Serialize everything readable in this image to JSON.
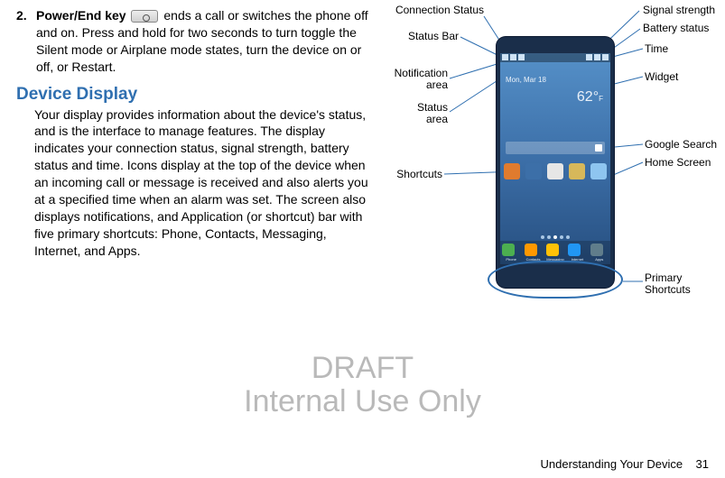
{
  "listItem": {
    "number": "2.",
    "label": "Power/End key",
    "textA": " ends a call or switches the phone off and on. Press and hold for two seconds to turn toggle the Silent mode or Airplane mode states, turn the device on or off, or Restart."
  },
  "sectionHead": "Device Display",
  "bodyPara": "Your display provides information about the device's status, and is the interface to manage features. The display indicates your connection status, signal strength, battery status and time. Icons display at the top of the device when an incoming call or message is received and also alerts you at a specified time when an alarm was set. The screen also displays notifications, and Application (or shortcut) bar with five primary shortcuts: Phone, Contacts, Messaging, Internet, and Apps.",
  "callouts": {
    "signal": "Signal strength",
    "battery": "Battery status",
    "connection": "Connection Status",
    "statusbar": "Status Bar",
    "time": "Time",
    "widget": "Widget",
    "notification": "Notification\narea",
    "statusarea": "Status\narea",
    "gsearch": "Google Search",
    "homescreen": "Home Screen",
    "shortcuts": "Shortcuts",
    "primary": "Primary\nShortcuts"
  },
  "phone": {
    "date": "Mon, Mar 18",
    "temp": "62°",
    "dock": [
      "Phone",
      "Contacts",
      "Messaging",
      "Internet",
      "Apps"
    ]
  },
  "watermark1": "DRAFT",
  "watermark2": "Internal Use Only",
  "footerTitle": "Understanding Your Device",
  "footerPage": "31"
}
